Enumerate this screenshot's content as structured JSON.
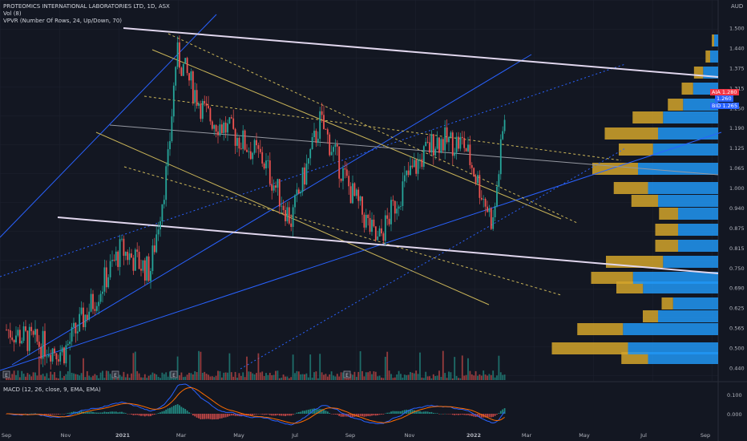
{
  "header": {
    "symbol_line": "PROTEOMICS INTERNATIONAL LABORATORIES LTD, 1D, ASX",
    "vol_line": "Vol (8)",
    "vpvr_line": "VPVR (Number Of Rows, 24, Up/Down, 70)",
    "macd_line": "MACD (12, 26, close, 9, EMA, EMA)",
    "currency": "AUD"
  },
  "price_tags": [
    {
      "prefix": "AIA",
      "value": "1.280",
      "color": "#f23645"
    },
    {
      "value": "1.260",
      "color": "#2962ff"
    },
    {
      "prefix": "BID",
      "value": "1.265",
      "color": "#2962ff"
    }
  ],
  "chart_data": [
    {
      "type": "candlestick",
      "title": "PROTEOMICS INTERNATIONAL LABORATORIES LTD, 1D, ASX",
      "y_ticks": [
        "1.500",
        "1.440",
        "1.375",
        "1.315",
        "1.250",
        "1.190",
        "1.125",
        "1.065",
        "1.000",
        "0.940",
        "0.875",
        "0.815",
        "0.750",
        "0.690",
        "0.625",
        "0.565",
        "0.500",
        "0.440"
      ],
      "x_ticks": [
        "Sep",
        "Nov",
        "2021",
        "Mar",
        "May",
        "Jul",
        "Sep",
        "Nov",
        "2022",
        "Mar",
        "May",
        "Jul",
        "Sep"
      ],
      "ylim": [
        0.44,
        1.5
      ],
      "close_path": [
        {
          "x": "2020-09",
          "y": 0.56
        },
        {
          "x": "2020-10",
          "y": 0.52
        },
        {
          "x": "2020-11",
          "y": 0.49
        },
        {
          "x": "2020-12",
          "y": 0.64
        },
        {
          "x": "2021-01",
          "y": 0.81
        },
        {
          "x": "2021-02",
          "y": 0.74
        },
        {
          "x": "2021-02-20",
          "y": 1.08
        },
        {
          "x": "2021-03",
          "y": 1.42
        },
        {
          "x": "2021-04",
          "y": 1.23
        },
        {
          "x": "2021-05",
          "y": 1.17
        },
        {
          "x": "2021-06",
          "y": 1.09
        },
        {
          "x": "2021-07",
          "y": 0.9
        },
        {
          "x": "2021-08",
          "y": 1.21
        },
        {
          "x": "2021-09",
          "y": 1.0
        },
        {
          "x": "2021-10",
          "y": 0.83
        },
        {
          "x": "2021-11",
          "y": 1.03
        },
        {
          "x": "2021-12",
          "y": 1.15
        },
        {
          "x": "2022-01",
          "y": 1.14
        },
        {
          "x": "2022-02-01",
          "y": 0.89
        },
        {
          "x": "2022-02-15",
          "y": 1.27
        }
      ],
      "volume_profile_rows": [
        {
          "price": 0.47,
          "up": 0.35,
          "down": 0.7
        },
        {
          "price": 0.5,
          "up": 1.0,
          "down": 0.9
        },
        {
          "price": 0.56,
          "up": 0.6,
          "down": 0.95
        },
        {
          "price": 0.6,
          "up": 0.2,
          "down": 0.6
        },
        {
          "price": 0.64,
          "up": 0.15,
          "down": 0.45
        },
        {
          "price": 0.69,
          "up": 0.35,
          "down": 0.75
        },
        {
          "price": 0.72,
          "up": 0.55,
          "down": 0.85
        },
        {
          "price": 0.77,
          "up": 0.75,
          "down": 0.55
        },
        {
          "price": 0.82,
          "up": 0.3,
          "down": 0.4
        },
        {
          "price": 0.87,
          "up": 0.3,
          "down": 0.4
        },
        {
          "price": 0.92,
          "up": 0.25,
          "down": 0.4
        },
        {
          "price": 0.96,
          "up": 0.35,
          "down": 0.6
        },
        {
          "price": 1.0,
          "up": 0.45,
          "down": 0.7
        },
        {
          "price": 1.06,
          "up": 0.6,
          "down": 0.8
        },
        {
          "price": 1.12,
          "up": 0.45,
          "down": 0.65
        },
        {
          "price": 1.17,
          "up": 0.7,
          "down": 0.6
        },
        {
          "price": 1.22,
          "up": 0.4,
          "down": 0.55
        },
        {
          "price": 1.26,
          "up": 0.2,
          "down": 0.35
        },
        {
          "price": 1.31,
          "up": 0.15,
          "down": 0.25
        },
        {
          "price": 1.36,
          "up": 0.12,
          "down": 0.15
        },
        {
          "price": 1.41,
          "up": 0.06,
          "down": 0.08
        },
        {
          "price": 1.46,
          "up": 0.03,
          "down": 0.04
        }
      ]
    },
    {
      "type": "line",
      "title": "MACD (12, 26, close, 9, EMA, EMA)",
      "y_ticks": [
        "0.100",
        "0.000"
      ]
    }
  ],
  "colors": {
    "background": "#131722",
    "up": "#26a69a",
    "down": "#ef5350",
    "vp_up": "#2196f3",
    "vp_down": "#d4a52a",
    "trendline_white": "#e1d7ee",
    "channel_blue": "#2962ff",
    "channel_yellow": "#c9b458"
  },
  "markers": [
    "E",
    "E",
    "E",
    "E"
  ]
}
